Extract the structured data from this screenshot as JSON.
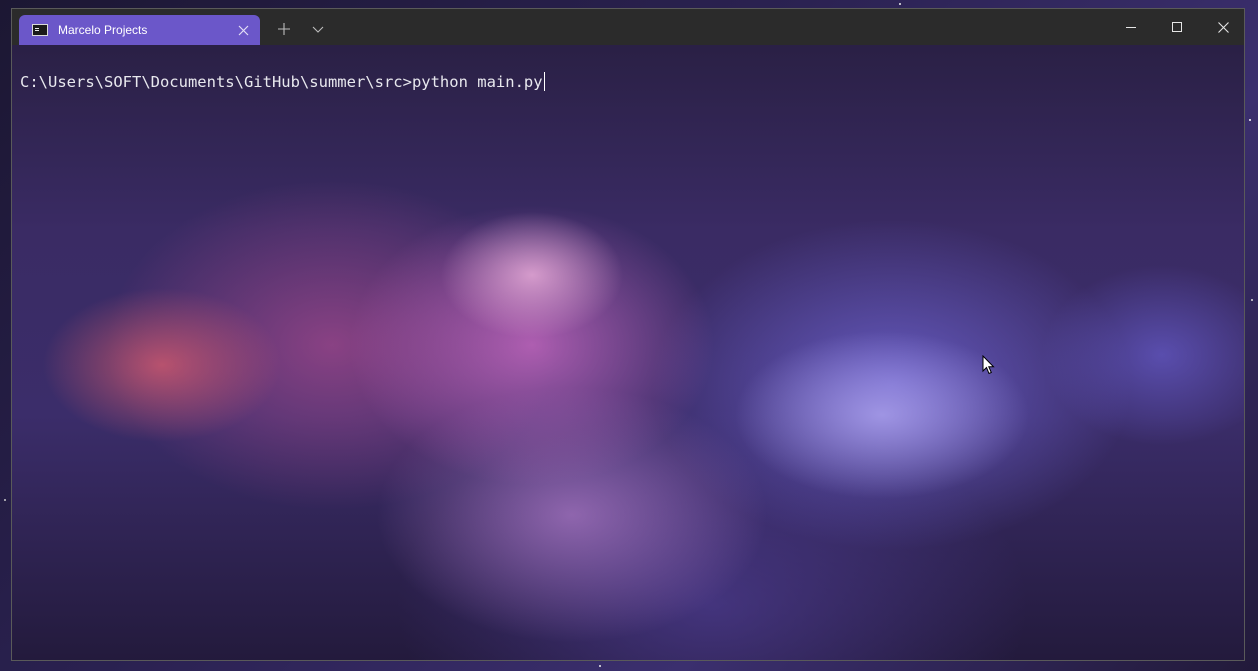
{
  "window": {
    "tab": {
      "title": "Marcelo Projects",
      "icon": "command-prompt-icon",
      "close_symbol": "✕"
    },
    "new_tab_symbol": "+",
    "controls": {
      "minimize_icon": "minimize-icon",
      "maximize_icon": "maximize-icon",
      "close_icon": "close-icon"
    }
  },
  "terminal": {
    "prompt": "C:\\Users\\SOFT\\Documents\\GitHub\\summer\\src>",
    "command": "python main.py"
  },
  "colors": {
    "tab_accent": "#6b57c9",
    "titlebar": "#2b2b2b",
    "text": "#e8e8ee"
  }
}
